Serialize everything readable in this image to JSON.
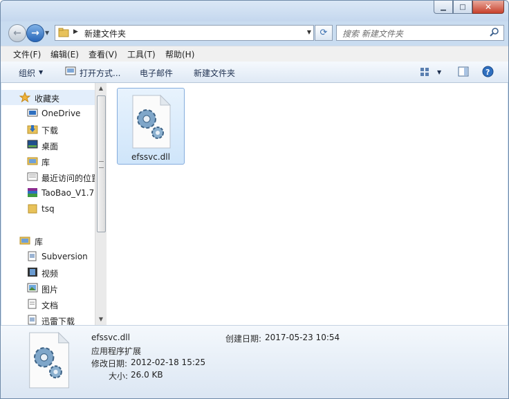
{
  "address": {
    "path": "新建文件夹"
  },
  "search": {
    "placeholder": "搜索 新建文件夹"
  },
  "menubar": [
    "文件(F)",
    "编辑(E)",
    "查看(V)",
    "工具(T)",
    "帮助(H)"
  ],
  "toolbar": {
    "organize": "组织",
    "open_with": "打开方式...",
    "email": "电子邮件",
    "new_folder": "新建文件夹"
  },
  "sidebar": {
    "favorites_header": "收藏夹",
    "favorites": [
      "OneDrive",
      "下载",
      "桌面",
      "库",
      "最近访问的位置",
      "TaoBao_V1.7",
      "tsq"
    ],
    "libraries_header": "库",
    "libraries": [
      "Subversion",
      "视频",
      "图片",
      "文档",
      "迅雷下载"
    ]
  },
  "files": [
    {
      "name": "efssvc.dll"
    }
  ],
  "details": {
    "name": "efssvc.dll",
    "type": "应用程序扩展",
    "modified_label": "修改日期:",
    "modified": "2012-02-18 15:25",
    "size_label": "大小:",
    "size": "26.0 KB",
    "created_label": "创建日期:",
    "created": "2017-05-23 10:54"
  }
}
